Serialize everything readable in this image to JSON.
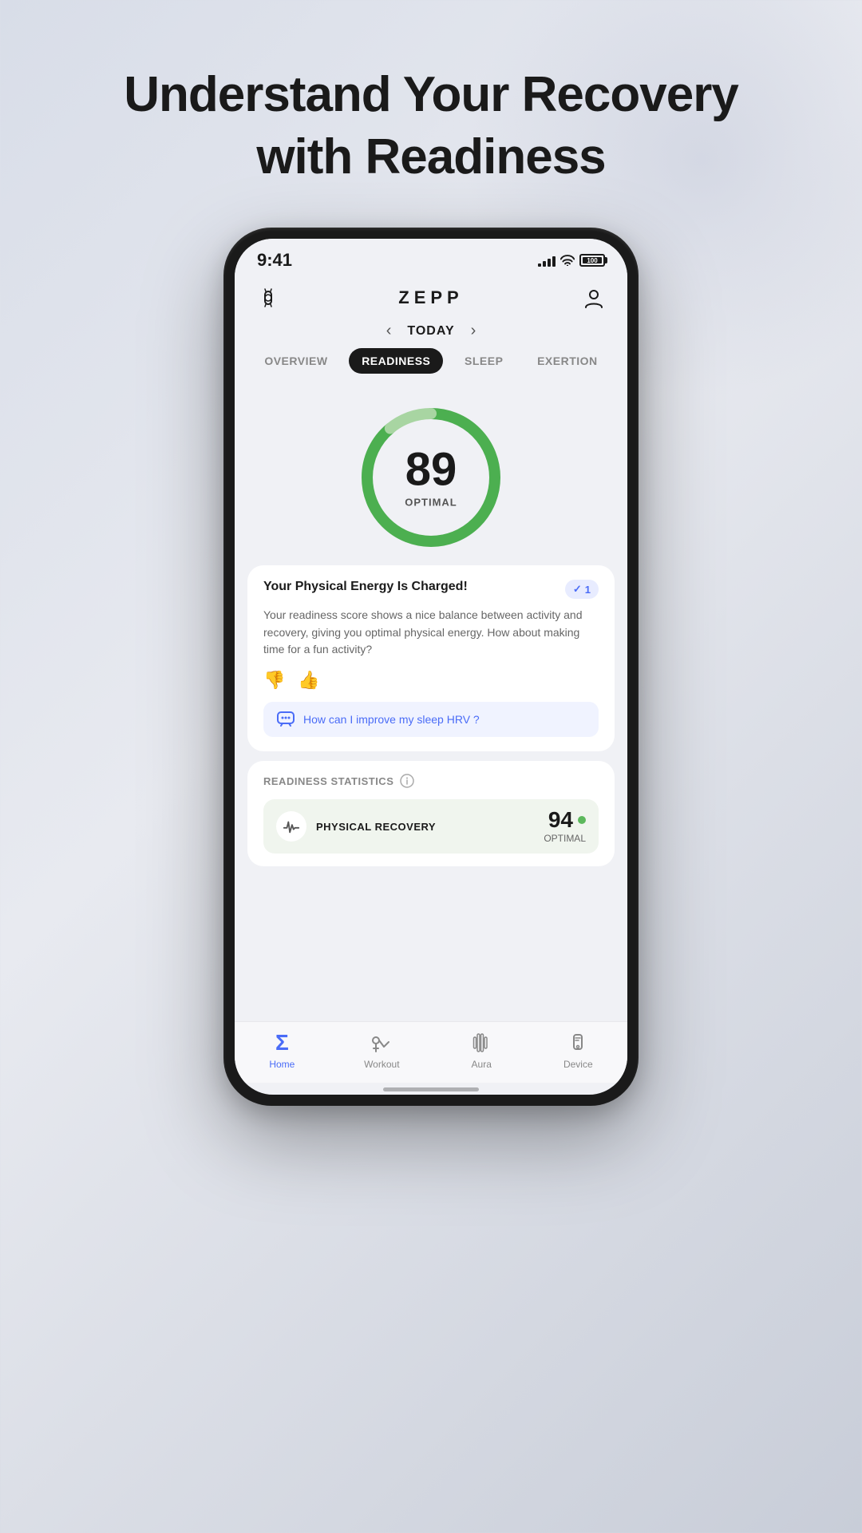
{
  "page": {
    "background_title_line1": "Understand Your Recovery",
    "background_title_line2": "with Readiness"
  },
  "status_bar": {
    "time": "9:41",
    "battery_label": "100"
  },
  "header": {
    "logo": "ZEPP",
    "watch_icon": "watch-icon",
    "profile_icon": "profile-icon"
  },
  "date_nav": {
    "label": "TODAY",
    "prev_arrow": "‹",
    "next_arrow": "›"
  },
  "tabs": [
    {
      "id": "overview",
      "label": "OVERVIEW",
      "active": false
    },
    {
      "id": "readiness",
      "label": "READINESS",
      "active": true
    },
    {
      "id": "sleep",
      "label": "SLEEP",
      "active": false
    },
    {
      "id": "exertion",
      "label": "EXERTION",
      "active": false
    }
  ],
  "score": {
    "value": "89",
    "label": "OPTIMAL",
    "percent": 89
  },
  "energy_card": {
    "title": "Your Physical Energy Is Charged!",
    "badge_count": "1",
    "body": "Your readiness score shows a nice balance between activity and recovery, giving you optimal physical energy. How about making time for a fun activity?",
    "thumbs_down": "👎",
    "thumbs_up": "👍",
    "ai_chat_label": "How can I improve my sleep HRV ?"
  },
  "readiness_stats": {
    "section_title": "READINESS STATISTICS",
    "rows": [
      {
        "id": "physical-recovery",
        "icon": "heartbeat-icon",
        "name": "PHYSICAL RECOVERY",
        "value": "94",
        "dot_color": "#5cb85c",
        "sublabel": "OPTIMAL"
      }
    ]
  },
  "bottom_nav": {
    "items": [
      {
        "id": "home",
        "label": "Home",
        "active": true
      },
      {
        "id": "workout",
        "label": "Workout",
        "active": false
      },
      {
        "id": "aura",
        "label": "Aura",
        "active": false
      },
      {
        "id": "device",
        "label": "Device",
        "active": false
      }
    ]
  }
}
